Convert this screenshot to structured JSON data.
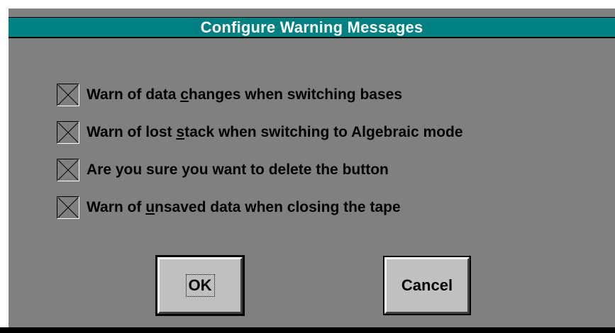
{
  "dialog": {
    "title": "Configure Warning Messages",
    "options": [
      {
        "pre": "Warn of data ",
        "accel": "c",
        "post": "hanges when switching bases",
        "checked": true
      },
      {
        "pre": "Warn of lost ",
        "accel": "s",
        "post": "tack when switching to Algebraic mode",
        "checked": true
      },
      {
        "pre": "Are you sure you want to delete the button",
        "accel": "",
        "post": "",
        "checked": true
      },
      {
        "pre": "Warn of ",
        "accel": "u",
        "post": "nsaved data when closing the tape",
        "checked": true
      }
    ],
    "ok_label": "OK",
    "cancel_label": "Cancel"
  },
  "colors": {
    "title_bar": "#008080",
    "dialog_bg": "#808080",
    "button_face": "#c0c0c0"
  }
}
